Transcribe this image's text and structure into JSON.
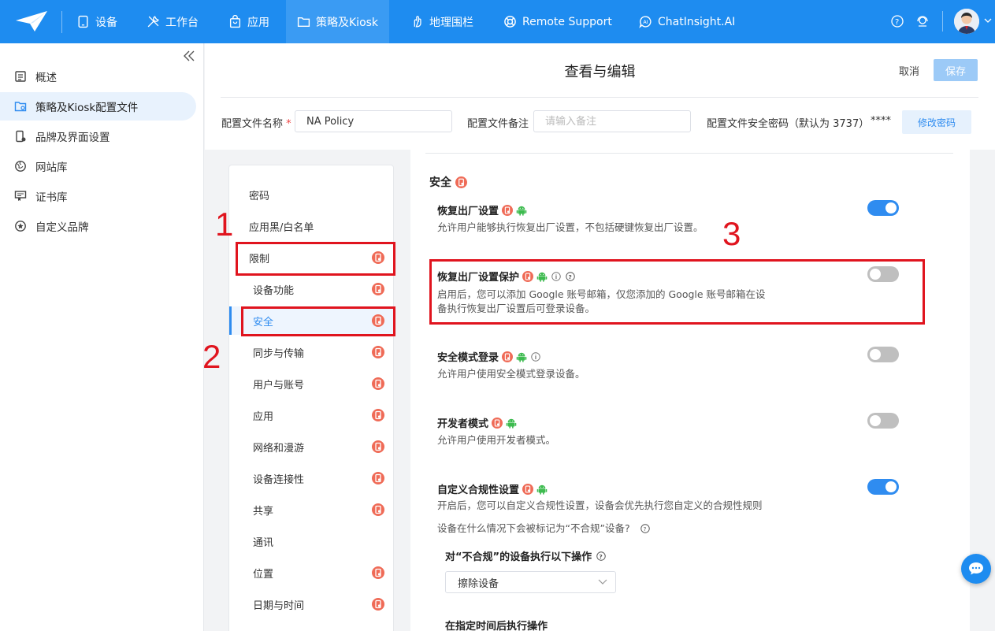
{
  "nav": {
    "items": [
      {
        "label": "设备",
        "icon": "tablet-icon"
      },
      {
        "label": "工作台",
        "icon": "tools-icon"
      },
      {
        "label": "应用",
        "icon": "app-bag-icon"
      },
      {
        "label": "策略及Kiosk",
        "icon": "folder-icon",
        "active": true
      },
      {
        "label": "地理围栏",
        "icon": "map-hand-icon"
      },
      {
        "label": "Remote Support",
        "icon": "lifebuoy-icon"
      },
      {
        "label": "ChatInsight.AI",
        "icon": "ai-chat-icon"
      }
    ],
    "brand_color": "#1e8cf0"
  },
  "sidebar": {
    "items": [
      {
        "label": "概述",
        "icon": "overview-icon"
      },
      {
        "label": "策略及Kiosk配置文件",
        "icon": "policy-folder-icon",
        "active": true
      },
      {
        "label": "品牌及界面设置",
        "icon": "brand-phone-icon"
      },
      {
        "label": "网站库",
        "icon": "globe-icon"
      },
      {
        "label": "证书库",
        "icon": "certificate-icon"
      },
      {
        "label": "自定义品牌",
        "icon": "star-circle-icon"
      }
    ]
  },
  "header": {
    "title": "查看与编辑",
    "cancel": "取消",
    "save": "保存",
    "profile_name_label": "配置文件名称",
    "required_mark": "*",
    "profile_name_value": "NA Policy",
    "profile_note_label": "配置文件备注",
    "profile_note_placeholder": "请输入备注",
    "security_pwd_label": "配置文件安全密码（默认为 3737）",
    "security_pwd_mask": "****",
    "modify_pwd": "修改密码"
  },
  "submenu": {
    "items": [
      {
        "label": "密码",
        "level": "top",
        "badge": false
      },
      {
        "label": "应用黑/白名单",
        "level": "top",
        "badge": false
      },
      {
        "label": "限制",
        "level": "top",
        "badge": true
      },
      {
        "label": "设备功能",
        "level": "sub",
        "badge": true
      },
      {
        "label": "安全",
        "level": "sub",
        "badge": true,
        "active": true
      },
      {
        "label": "同步与传输",
        "level": "sub",
        "badge": true
      },
      {
        "label": "用户与账号",
        "level": "sub",
        "badge": true
      },
      {
        "label": "应用",
        "level": "sub",
        "badge": true
      },
      {
        "label": "网络和漫游",
        "level": "sub",
        "badge": true
      },
      {
        "label": "设备连接性",
        "level": "sub",
        "badge": true
      },
      {
        "label": "共享",
        "level": "sub",
        "badge": true
      },
      {
        "label": "通讯",
        "level": "sub",
        "badge": false
      },
      {
        "label": "位置",
        "level": "sub",
        "badge": true
      },
      {
        "label": "日期与时间",
        "level": "sub",
        "badge": true
      }
    ]
  },
  "annotations": {
    "n1": "1",
    "n2": "2",
    "n3": "3"
  },
  "content": {
    "section_title": "安全",
    "settings": [
      {
        "title": "恢复出厂设置",
        "desc": [
          "允许用户能够执行恢复出厂设置，不包括硬键恢复出厂设置。"
        ],
        "enabled": true,
        "info": false,
        "help": false
      },
      {
        "title": "恢复出厂设置保护",
        "desc": [
          "启用后，您可以添加 Google 账号邮箱，仅您添加的 Google 账号邮箱在设",
          "备执行恢复出厂设置后可登录设备。"
        ],
        "enabled": false,
        "info": true,
        "help": true
      },
      {
        "title": "安全模式登录",
        "desc": [
          "允许用户使用安全模式登录设备。"
        ],
        "enabled": false,
        "info": true,
        "help": false
      },
      {
        "title": "开发者模式",
        "desc": [
          "允许用户使用开发者模式。"
        ],
        "enabled": false,
        "info": false,
        "help": false
      },
      {
        "title": "自定义合规性设置",
        "desc": [
          "开启后，您可以自定义合规性设置，设备会优先执行您自定义的合规性规则"
        ],
        "enabled": true,
        "info": false,
        "help": false
      }
    ],
    "noncompliant_question": "设备在什么情况下会被标记为“不合规”设备?",
    "action_title": "对“不合规”的设备执行以下操作",
    "action_select": "擦除设备",
    "delay_title": "在指定时间后执行操作"
  }
}
